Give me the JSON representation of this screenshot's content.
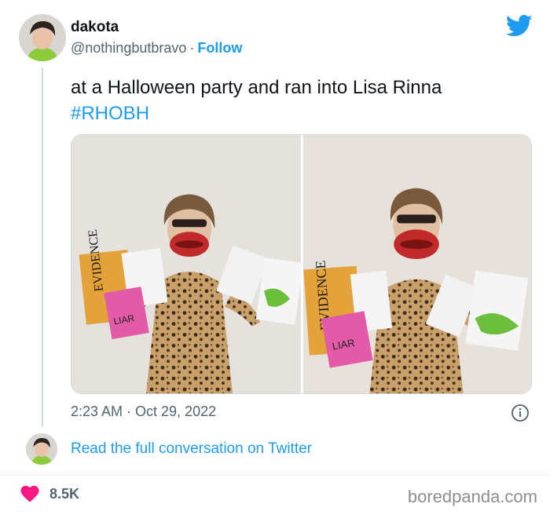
{
  "author": {
    "display_name": "dakota",
    "handle": "@nothingbutbravo",
    "separator": "·",
    "follow_label": "Follow",
    "avatar_icon": "user-avatar-icon"
  },
  "tweet": {
    "text": "at a Halloween party and ran into Lisa Rinna",
    "hashtag": "#RHOBH",
    "timestamp": "2:23 AM · Oct 29, 2022"
  },
  "media": {
    "photo_count": 2,
    "left_sign_text": "EVIDENCE",
    "left_card_text": "LIAR",
    "right_sign_text": "EVIDENCE",
    "right_card_text": "LIAR"
  },
  "conversation": {
    "link_label": "Read the full conversation on Twitter"
  },
  "engagement": {
    "likes": "8.5K"
  },
  "watermark": "boredpanda.com",
  "colors": {
    "twitter_blue": "#1d9bf0",
    "heart": "#f91880",
    "secondary_text": "#536471"
  },
  "icons": [
    "twitter-bird-icon",
    "info-icon",
    "heart-icon"
  ]
}
